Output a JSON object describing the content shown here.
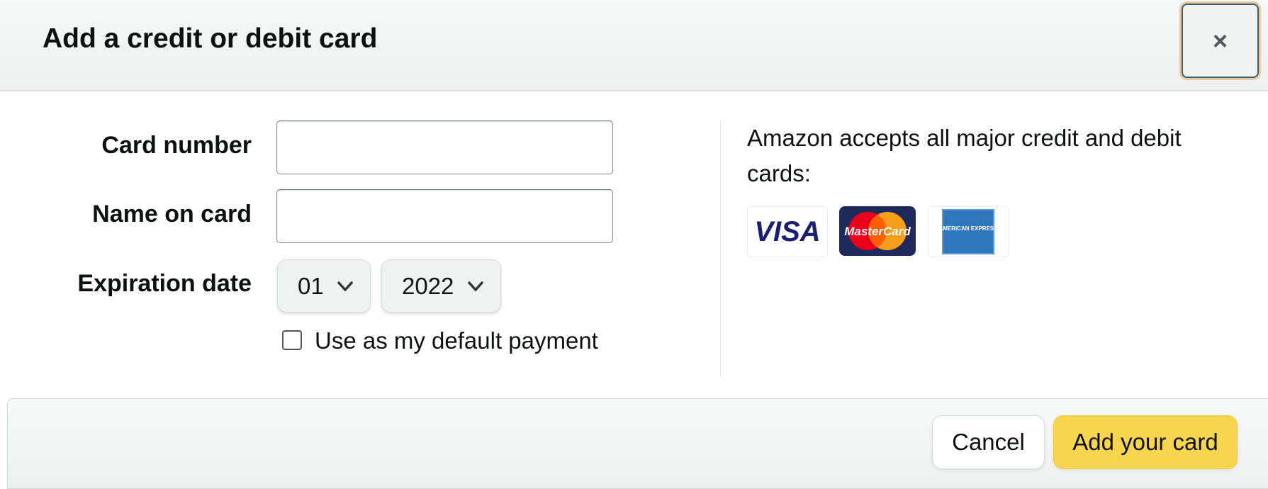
{
  "dialog": {
    "title": "Add a credit or debit card",
    "close_label": "×"
  },
  "form": {
    "card_number_label": "Card number",
    "card_number_value": "",
    "name_label": "Name on card",
    "name_value": "",
    "expiration_label": "Expiration date",
    "exp_month": "01",
    "exp_year": "2022",
    "default_payment_label": "Use as my default payment",
    "default_payment_checked": false
  },
  "info": {
    "accept_text": "Amazon accepts all major credit and debit cards:",
    "logos": [
      {
        "name": "visa",
        "text": "VISA",
        "color": "#1a1f71"
      },
      {
        "name": "mastercard",
        "text": "MasterCard",
        "colors": [
          "#eb001b",
          "#f79e1b",
          "#1f2a5c"
        ]
      },
      {
        "name": "american-express",
        "text": "AMERICAN EXPRESS",
        "color": "#2e77bc"
      }
    ]
  },
  "footer": {
    "cancel_label": "Cancel",
    "add_label": "Add your card"
  },
  "colors": {
    "primary_button": "#f7d54c",
    "header_bg": "#f0f2f2",
    "focus_ring": "#e8c9a3"
  }
}
